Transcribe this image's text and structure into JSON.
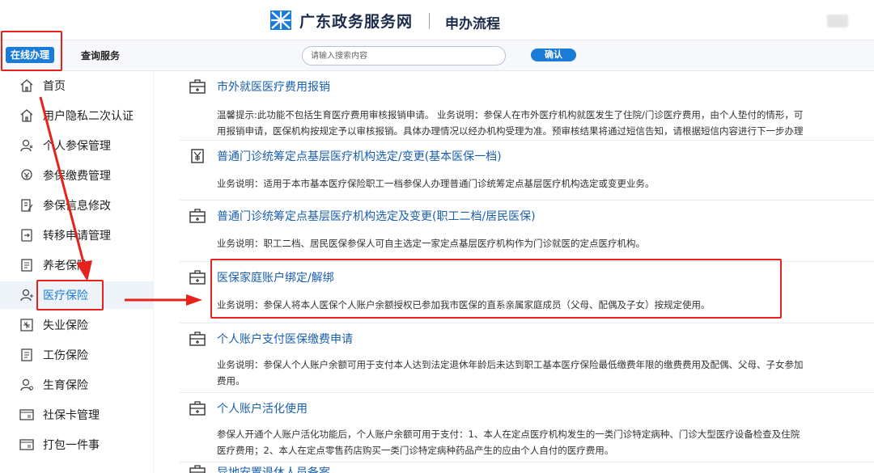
{
  "header": {
    "site_title": "广东政务服务网",
    "process_title": "申办流程"
  },
  "topnav": {
    "tabs": [
      {
        "label": "在线办理",
        "active": true
      },
      {
        "label": "查询服务",
        "active": false
      }
    ],
    "search_placeholder": "请输入搜索内容",
    "search_button": "确认"
  },
  "sidebar": {
    "items": [
      {
        "label": "首页",
        "icon": "home-icon"
      },
      {
        "label": "用户隐私二次认证",
        "icon": "home-icon"
      },
      {
        "label": "个人参保管理",
        "icon": "person-icon"
      },
      {
        "label": "参保缴费管理",
        "icon": "payment-icon"
      },
      {
        "label": "参保信息修改",
        "icon": "edit-icon"
      },
      {
        "label": "转移申请管理",
        "icon": "transfer-icon"
      },
      {
        "label": "养老保险",
        "icon": "document-icon"
      },
      {
        "label": "医疗保险",
        "icon": "person-icon",
        "active": true
      },
      {
        "label": "失业保险",
        "icon": "unemployment-icon"
      },
      {
        "label": "工伤保险",
        "icon": "document-icon"
      },
      {
        "label": "生育保险",
        "icon": "person-icon"
      },
      {
        "label": "社保卡管理",
        "icon": "card-icon"
      },
      {
        "label": "打包一件事",
        "icon": "card-icon"
      }
    ]
  },
  "services": [
    {
      "title": "市外就医医疗费用报销",
      "icon": "medical-kit-icon",
      "desc": [
        "温馨提示:此功能不包括生育医疗费用审核报销申请。 业务说明：参保人在市外医疗机构就医发生了住院/门诊医疗费用，由个人垫付的情形，可",
        "用报销申请，医保机构按规定予以审核报销。具体办理情况以经办机构受理为准。预审核结果将通过短信告知，请根据短信内容进行下一步办理"
      ]
    },
    {
      "title": "普通门诊统筹定点基层医疗机构选定/变更(基本医保一档)",
      "icon": "yuan-icon",
      "desc": [
        "业务说明：适用于本市基本医疗保险职工一档参保人办理普通门诊统筹定点基层医疗机构选定或变更业务。"
      ]
    },
    {
      "title": "普通门诊统筹定点基层医疗机构选定及变更(职工二档/居民医保)",
      "icon": "medical-kit-icon",
      "desc": [
        "业务说明：职工二档、居民医保参保人可自主选定一家定点基层医疗机构作为门诊就医的定点医疗机构。"
      ]
    },
    {
      "title": "医保家庭账户绑定/解绑",
      "icon": "medical-kit-icon",
      "desc": [
        "业务说明：参保人将本人医保个人账户余额授权已参加我市医保的直系亲属家庭成员（父母、配偶及子女）按规定使用。"
      ]
    },
    {
      "title": "个人账户支付医保缴费申请",
      "icon": "medical-kit-icon",
      "desc": [
        "业务说明：参保人个人账户余额可用于支付本人达到法定退休年龄后未达到职工基本医疗保险最低缴费年限的缴费费用及配偶、父母、子女参加",
        "费用。"
      ]
    },
    {
      "title": "个人账户活化使用",
      "icon": "medical-kit-icon",
      "desc": [
        "参保人开通个人账户活化功能后，个人账户余额可用于支付：1、本人在定点医疗机构发生的一类门诊特定病种、门诊大型医疗设备检查及住院",
        "医疗费用；2、本人在定点零售药店购买一类门诊特定病种药品产生的应由个人自付的医疗费用。"
      ]
    },
    {
      "title": "异地安置退休人员备案",
      "icon": "medical-kit-icon",
      "desc": []
    }
  ],
  "annotation_color": "#e5231b"
}
